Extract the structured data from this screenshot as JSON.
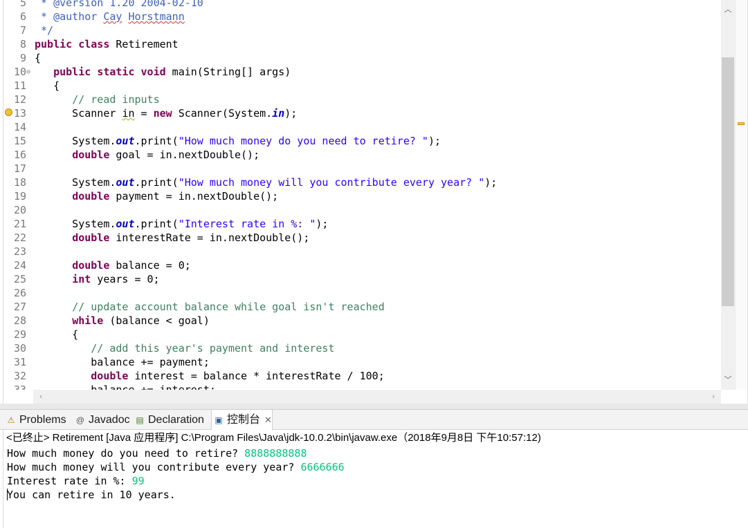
{
  "editor": {
    "lines": [
      {
        "num": "5",
        "tokens": [
          {
            "t": " * @version 1.20 2004-02-10",
            "c": "jd"
          }
        ]
      },
      {
        "num": "6",
        "tokens": [
          {
            "t": " * @author ",
            "c": "jd"
          },
          {
            "t": "Cay",
            "c": "jdu"
          },
          {
            "t": " ",
            "c": "jd"
          },
          {
            "t": "Horstmann",
            "c": "jdu"
          }
        ]
      },
      {
        "num": "7",
        "tokens": [
          {
            "t": " */",
            "c": "jd"
          }
        ]
      },
      {
        "num": "8",
        "tokens": [
          {
            "t": "public",
            "c": "k"
          },
          {
            "t": " "
          },
          {
            "t": "class",
            "c": "k"
          },
          {
            "t": " Retirement"
          }
        ]
      },
      {
        "num": "9",
        "tokens": [
          {
            "t": "{"
          }
        ]
      },
      {
        "num": "10",
        "fold": true,
        "tokens": [
          {
            "t": "   "
          },
          {
            "t": "public",
            "c": "k"
          },
          {
            "t": " "
          },
          {
            "t": "static",
            "c": "k"
          },
          {
            "t": " "
          },
          {
            "t": "void",
            "c": "k"
          },
          {
            "t": " main(String[] "
          },
          {
            "t": "args",
            "c": "p"
          },
          {
            "t": ")"
          }
        ]
      },
      {
        "num": "11",
        "tokens": [
          {
            "t": "   {"
          }
        ]
      },
      {
        "num": "12",
        "tokens": [
          {
            "t": "      "
          },
          {
            "t": "// read inputs",
            "c": "c"
          }
        ]
      },
      {
        "num": "13",
        "warn": true,
        "tokens": [
          {
            "t": "      Scanner "
          },
          {
            "t": "in",
            "c": "wv"
          },
          {
            "t": " = "
          },
          {
            "t": "new",
            "c": "k"
          },
          {
            "t": " Scanner(System."
          },
          {
            "t": "in",
            "c": "f"
          },
          {
            "t": ");"
          }
        ]
      },
      {
        "num": "14",
        "tokens": []
      },
      {
        "num": "15",
        "tokens": [
          {
            "t": "      System."
          },
          {
            "t": "out",
            "c": "f"
          },
          {
            "t": ".print("
          },
          {
            "t": "\"How much money do you need to retire? \"",
            "c": "s"
          },
          {
            "t": ");"
          }
        ]
      },
      {
        "num": "16",
        "tokens": [
          {
            "t": "      "
          },
          {
            "t": "double",
            "c": "k"
          },
          {
            "t": " goal = in.nextDouble();"
          }
        ]
      },
      {
        "num": "17",
        "tokens": []
      },
      {
        "num": "18",
        "tokens": [
          {
            "t": "      System."
          },
          {
            "t": "out",
            "c": "f"
          },
          {
            "t": ".print("
          },
          {
            "t": "\"How much money will you contribute every year? \"",
            "c": "s"
          },
          {
            "t": ");"
          }
        ]
      },
      {
        "num": "19",
        "tokens": [
          {
            "t": "      "
          },
          {
            "t": "double",
            "c": "k"
          },
          {
            "t": " payment = in.nextDouble();"
          }
        ]
      },
      {
        "num": "20",
        "tokens": []
      },
      {
        "num": "21",
        "tokens": [
          {
            "t": "      System."
          },
          {
            "t": "out",
            "c": "f"
          },
          {
            "t": ".print("
          },
          {
            "t": "\"Interest rate in %: \"",
            "c": "s"
          },
          {
            "t": ");"
          }
        ]
      },
      {
        "num": "22",
        "tokens": [
          {
            "t": "      "
          },
          {
            "t": "double",
            "c": "k"
          },
          {
            "t": " interestRate = in.nextDouble();"
          }
        ]
      },
      {
        "num": "23",
        "tokens": []
      },
      {
        "num": "24",
        "tokens": [
          {
            "t": "      "
          },
          {
            "t": "double",
            "c": "k"
          },
          {
            "t": " balance = 0;"
          }
        ]
      },
      {
        "num": "25",
        "tokens": [
          {
            "t": "      "
          },
          {
            "t": "int",
            "c": "k"
          },
          {
            "t": " years = 0;"
          }
        ]
      },
      {
        "num": "26",
        "tokens": []
      },
      {
        "num": "27",
        "tokens": [
          {
            "t": "      "
          },
          {
            "t": "// update account balance while goal isn't reached",
            "c": "c"
          }
        ]
      },
      {
        "num": "28",
        "tokens": [
          {
            "t": "      "
          },
          {
            "t": "while",
            "c": "k"
          },
          {
            "t": " (balance < goal)"
          }
        ]
      },
      {
        "num": "29",
        "tokens": [
          {
            "t": "      {"
          }
        ]
      },
      {
        "num": "30",
        "tokens": [
          {
            "t": "         "
          },
          {
            "t": "// add this year's payment and interest",
            "c": "c"
          }
        ]
      },
      {
        "num": "31",
        "tokens": [
          {
            "t": "         balance += payment;"
          }
        ]
      },
      {
        "num": "32",
        "tokens": [
          {
            "t": "         "
          },
          {
            "t": "double",
            "c": "k"
          },
          {
            "t": " interest = balance * interestRate / 100;"
          }
        ]
      },
      {
        "num": "33",
        "tokens": [
          {
            "t": "         balance += interest;"
          }
        ]
      }
    ]
  },
  "tabs": [
    {
      "label": "Problems",
      "icon": "problems-icon",
      "glyph": "⚠",
      "color": "#b07a00"
    },
    {
      "label": "Javadoc",
      "icon": "javadoc-icon",
      "glyph": "@",
      "color": "#555555"
    },
    {
      "label": "Declaration",
      "icon": "declaration-icon",
      "glyph": "▤",
      "color": "#4a7a2a"
    },
    {
      "label": "控制台",
      "icon": "console-icon",
      "glyph": "▣",
      "color": "#2f5f9f",
      "active": true,
      "close": "✕"
    }
  ],
  "console": {
    "header": "<已终止> Retirement [Java 应用程序] C:\\Program Files\\Java\\jdk-10.0.2\\bin\\javaw.exe（2018年9月8日 下午10:57:12)",
    "lines": [
      {
        "prompt": "How much money do you need to retire? ",
        "input": "8888888888"
      },
      {
        "prompt": "How much money will you contribute every year? ",
        "input": "6666666"
      },
      {
        "prompt": "Interest rate in %: ",
        "input": "99"
      },
      {
        "prompt": "You can retire in 10 years.",
        "input": ""
      }
    ]
  }
}
